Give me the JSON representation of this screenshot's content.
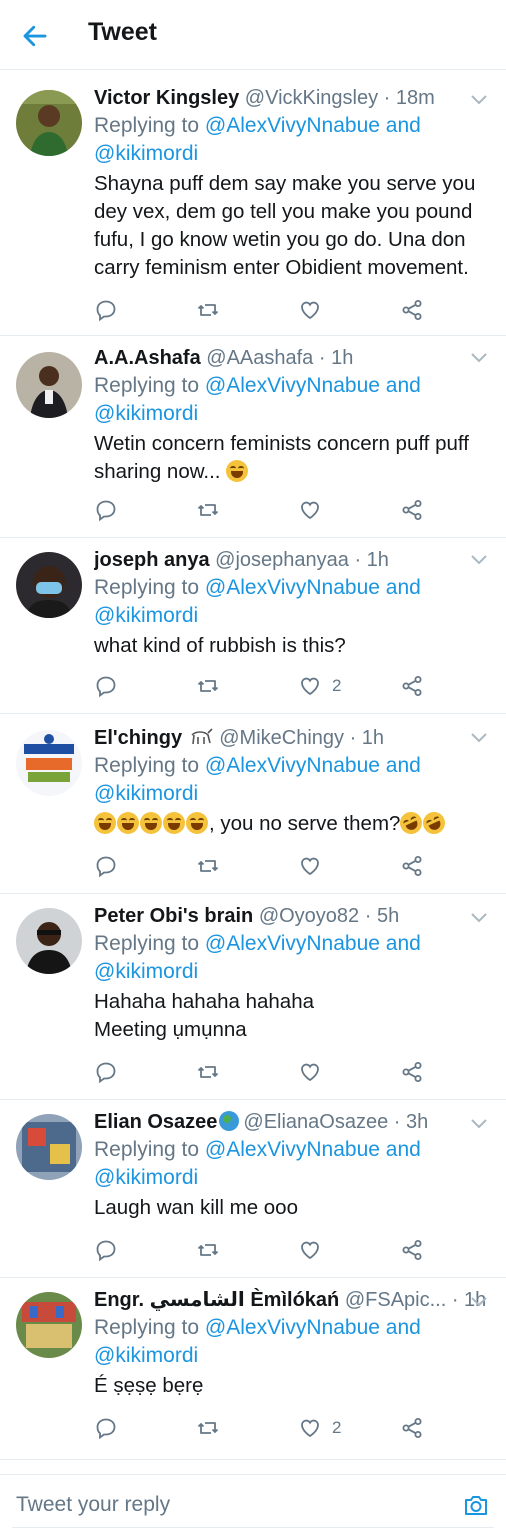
{
  "header": {
    "title": "Tweet"
  },
  "reply_prefix": "Replying to",
  "reply_to": "@AlexVivyNnabue and",
  "reply_to_2": "@kikimordi",
  "tweets": [
    {
      "name": "Victor Kingsley",
      "handle": "@VickKingsley",
      "time": " · 18m",
      "body": "Shayna puff dem say make you serve you dey vex, dem go tell you make you pound fufu, I go know wetin you go do. Una don carry feminism enter Obidient movement.",
      "likes": ""
    },
    {
      "name": "A.A.Ashafa",
      "handle": "@AAashafa",
      "time": " · 1h",
      "body": "Wetin concern feminists concern puff puff sharing now...",
      "likes": ""
    },
    {
      "name": "joseph anya",
      "handle": "@josephanyaa",
      "time": " · 1h",
      "body": "what kind of rubbish is this?",
      "likes": "2"
    },
    {
      "name": "El'chingy",
      "handle": "@MikeChingy",
      "time": " · 1h",
      "body": ", you no serve them?",
      "likes": ""
    },
    {
      "name": "Peter Obi's brain",
      "handle": "@Oyoyo82",
      "time": " · 5h",
      "body": "Hahaha hahaha hahaha",
      "body2": "Meeting ụmụnna",
      "likes": ""
    },
    {
      "name": "Elian Osazee",
      "handle": "@ElianaOsazee",
      "time": " · 3h",
      "body": "Laugh wan kill me ooo",
      "likes": ""
    },
    {
      "name": "Engr. الشامسي Èmìlókań",
      "handle": "@FSApic...",
      "time": " · 1h",
      "body": "É ṣẹṣẹ bẹrẹ",
      "likes": "2"
    }
  ],
  "footer": {
    "placeholder": "Tweet your reply"
  },
  "colors": {
    "accent": "#1b95e0",
    "text": "#14171a",
    "muted": "#657786",
    "divider": "#e6ecf0"
  }
}
